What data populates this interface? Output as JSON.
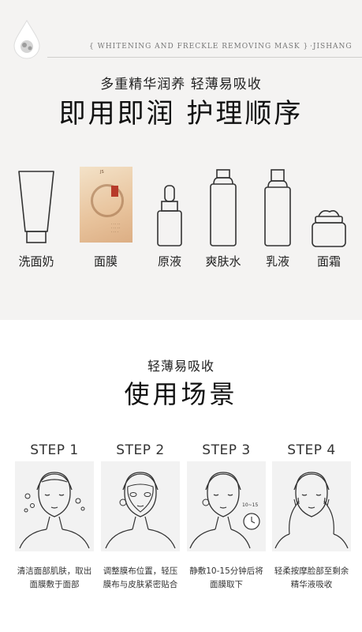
{
  "header": {
    "banner": "{ WHITENING AND FRECKLE REMOVING MASK }",
    "brand": "·JISHANG",
    "subtitle": "多重精华润养 轻薄易吸收",
    "title": "即用即润 护理顺序"
  },
  "products": [
    {
      "label": "洗面奶",
      "icon": "tube-icon"
    },
    {
      "label": "面膜",
      "icon": "mask-packet-icon"
    },
    {
      "label": "原液",
      "icon": "dropper-bottle-icon"
    },
    {
      "label": "爽肤水",
      "icon": "toner-bottle-icon"
    },
    {
      "label": "乳液",
      "icon": "lotion-bottle-icon"
    },
    {
      "label": "面霜",
      "icon": "cream-jar-icon"
    }
  ],
  "usage": {
    "subtitle": "轻薄易吸收",
    "title": "使用场景"
  },
  "steps": [
    {
      "title": "STEP 1",
      "desc": "清洁面部肌肤，取出面膜敷于面部",
      "icon": "face-cleanse-icon"
    },
    {
      "title": "STEP 2",
      "desc": "调整膜布位置，轻压膜布与皮肤紧密贴合",
      "icon": "face-mask-apply-icon"
    },
    {
      "title": "STEP 3",
      "desc": "静敷10-15分钟后将面膜取下",
      "icon": "face-timer-icon",
      "timer_label": "10~15"
    },
    {
      "title": "STEP 4",
      "desc": "轻柔按摩脸部至剩余精华液吸收",
      "icon": "face-massage-icon"
    }
  ],
  "colors": {
    "top_bg": "#f4f3f2",
    "step_bg": "#f2f2f2",
    "line": "#333333"
  }
}
